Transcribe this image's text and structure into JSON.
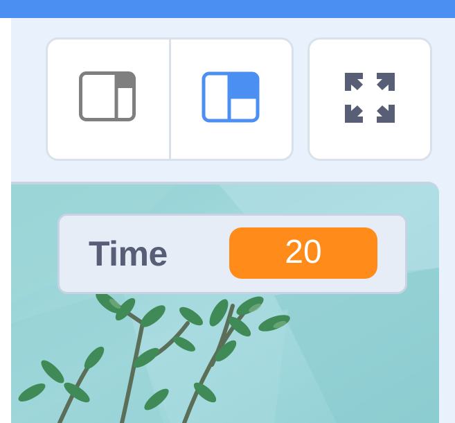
{
  "toolbar": {
    "buttons": [
      {
        "name": "small-stage-button",
        "icon": "small-stage-icon",
        "active": false
      },
      {
        "name": "normal-stage-button",
        "icon": "normal-stage-icon",
        "active": true
      },
      {
        "name": "fullscreen-button",
        "icon": "fullscreen-icon",
        "active": false
      }
    ]
  },
  "monitor": {
    "label": "Time",
    "value": "20"
  },
  "colors": {
    "accent": "#4c8ff2",
    "monitor_value_bg": "#ff8c1a",
    "monitor_label": "#575e75",
    "inactive_icon": "#7f7f7f"
  }
}
